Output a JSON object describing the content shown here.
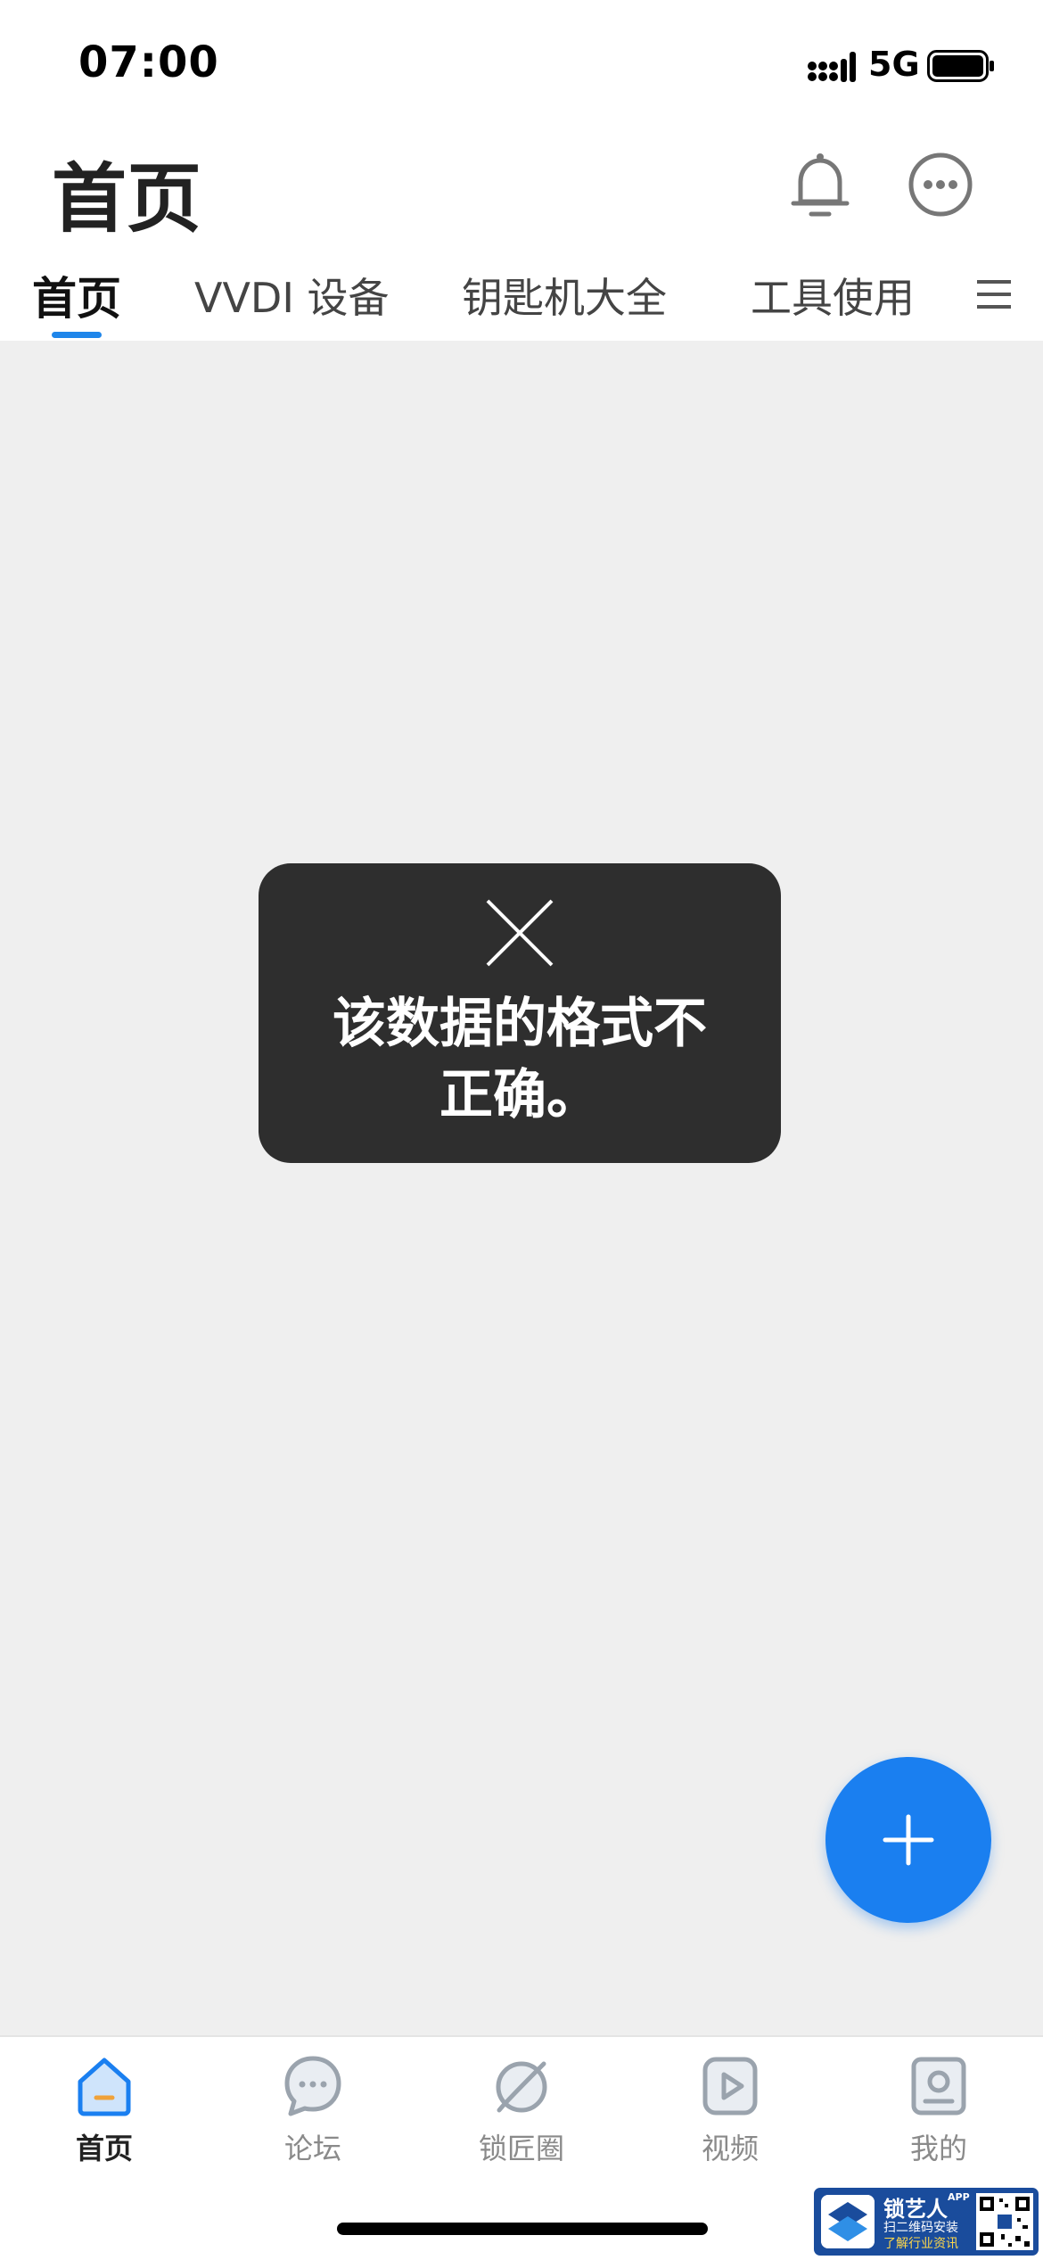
{
  "status_bar": {
    "time": "07:00",
    "network": "5G",
    "icons": [
      "signal-icon",
      "battery-icon"
    ]
  },
  "header": {
    "title": "首页",
    "icons": [
      "bell-icon",
      "more-icon"
    ]
  },
  "tabs": [
    {
      "label": "首页",
      "active": true
    },
    {
      "label": "VVDI 设备",
      "active": false
    },
    {
      "label": "钥匙机大全",
      "active": false
    },
    {
      "label": "工具使用",
      "active": false
    }
  ],
  "tab_menu_icon": "menu-icon",
  "toast": {
    "icon": "close-icon",
    "message_line1": "该数据的格式不",
    "message_line2": "正确。"
  },
  "fab": {
    "icon": "plus-icon"
  },
  "bottom_nav": [
    {
      "label": "首页",
      "icon": "home-icon",
      "active": true
    },
    {
      "label": "论坛",
      "icon": "chat-bubble-icon",
      "active": false
    },
    {
      "label": "锁匠圈",
      "icon": "planet-icon",
      "active": false
    },
    {
      "label": "视频",
      "icon": "play-icon",
      "active": false
    },
    {
      "label": "我的",
      "icon": "profile-icon",
      "active": false
    }
  ],
  "watermark": {
    "title": "锁艺人",
    "superscript": "APP",
    "line1": "扫二维码安装",
    "line2": "了解行业资讯"
  },
  "colors": {
    "accent": "#1a7ff0",
    "toast_bg": "#2e2e2e",
    "background": "#efefef",
    "inactive": "#8a8a8a"
  }
}
